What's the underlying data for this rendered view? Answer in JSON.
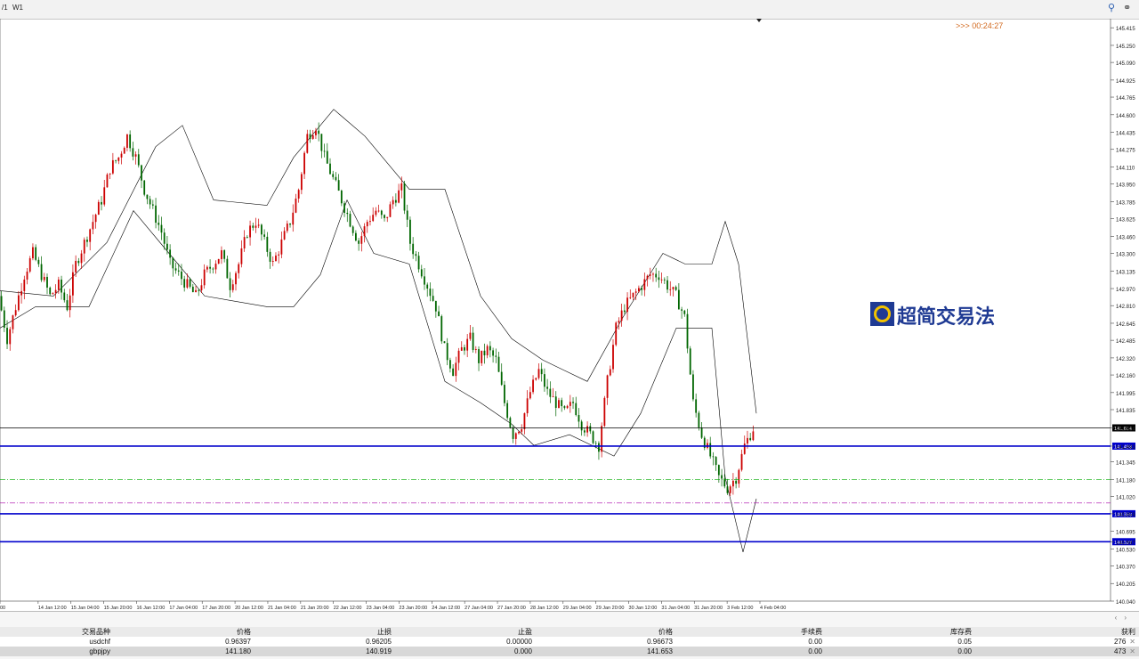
{
  "toolbar": {
    "timeframes": [
      "/1",
      "W1"
    ],
    "search_icon": "magnifier-icon",
    "tool_icon": "link-icon"
  },
  "countdown": ">>> 00:24:27",
  "watermark": {
    "text": "超简交易法",
    "icon": "logo-icon"
  },
  "chart_data": {
    "type": "candlestick",
    "symbol_price_current": 141.664,
    "y_ticks": [
      145.415,
      145.25,
      145.09,
      144.925,
      144.765,
      144.6,
      144.435,
      144.275,
      144.11,
      143.95,
      143.785,
      143.625,
      143.46,
      143.3,
      143.135,
      142.97,
      142.81,
      142.645,
      142.485,
      142.32,
      142.16,
      141.995,
      141.835,
      141.664,
      141.493,
      141.345,
      141.18,
      141.02,
      140.859,
      140.695,
      140.597,
      140.53,
      140.37,
      140.205,
      140.04
    ],
    "ylim": [
      140.04,
      145.5
    ],
    "x_ticks": [
      "00",
      "14 Jan 12:00",
      "15 Jan 04:00",
      "15 Jan 20:00",
      "16 Jan 12:00",
      "17 Jan 04:00",
      "17 Jan 20:00",
      "20 Jan 12:00",
      "21 Jan 04:00",
      "21 Jan 20:00",
      "22 Jan 12:00",
      "23 Jan 04:00",
      "23 Jan 20:00",
      "24 Jan 12:00",
      "27 Jan 04:00",
      "27 Jan 20:00",
      "28 Jan 12:00",
      "29 Jan 04:00",
      "29 Jan 20:00",
      "30 Jan 12:00",
      "31 Jan 04:00",
      "31 Jan 20:00",
      "3 Feb 12:00",
      "4 Feb 04:00"
    ],
    "price_trace": [
      142.9,
      142.5,
      142.8,
      143.1,
      143.3,
      143.1,
      142.9,
      143.0,
      142.8,
      143.2,
      143.4,
      143.6,
      143.8,
      144.1,
      144.2,
      144.4,
      144.2,
      143.9,
      143.7,
      143.5,
      143.2,
      143.1,
      143.0,
      142.9,
      143.1,
      143.2,
      143.3,
      143.0,
      143.2,
      143.5,
      143.6,
      143.4,
      143.2,
      143.4,
      143.6,
      143.9,
      144.4,
      144.5,
      144.2,
      144.0,
      143.8,
      143.6,
      143.4,
      143.6,
      143.7,
      143.6,
      143.8,
      143.9,
      143.4,
      143.2,
      143.0,
      142.8,
      142.4,
      142.2,
      142.4,
      142.5,
      142.3,
      142.4,
      142.3,
      141.9,
      141.6,
      141.7,
      142.0,
      142.2,
      142.0,
      141.9,
      141.8,
      141.9,
      141.7,
      141.6,
      141.5,
      142.1,
      142.6,
      142.8,
      142.9,
      143.0,
      143.1,
      143.1,
      143.0,
      142.9,
      142.7,
      141.9,
      141.6,
      141.4,
      141.2,
      141.1,
      141.2,
      141.5,
      141.66
    ],
    "upper_band_points": [
      [
        0,
        142.95
      ],
      [
        60,
        142.9
      ],
      [
        120,
        143.4
      ],
      [
        175,
        144.3
      ],
      [
        205,
        144.5
      ],
      [
        240,
        143.8
      ],
      [
        300,
        143.75
      ],
      [
        330,
        144.2
      ],
      [
        375,
        144.65
      ],
      [
        410,
        144.4
      ],
      [
        460,
        143.9
      ],
      [
        500,
        143.9
      ],
      [
        540,
        142.9
      ],
      [
        575,
        142.5
      ],
      [
        610,
        142.3
      ],
      [
        660,
        142.1
      ],
      [
        700,
        142.7
      ],
      [
        745,
        143.3
      ],
      [
        770,
        143.2
      ],
      [
        800,
        143.2
      ],
      [
        815,
        143.6
      ],
      [
        830,
        143.2
      ],
      [
        850,
        141.8
      ]
    ],
    "lower_band_points": [
      [
        0,
        142.6
      ],
      [
        40,
        142.8
      ],
      [
        100,
        142.8
      ],
      [
        150,
        143.7
      ],
      [
        190,
        143.3
      ],
      [
        230,
        142.9
      ],
      [
        300,
        142.8
      ],
      [
        330,
        142.8
      ],
      [
        360,
        143.1
      ],
      [
        390,
        143.8
      ],
      [
        420,
        143.3
      ],
      [
        460,
        143.2
      ],
      [
        500,
        142.1
      ],
      [
        540,
        141.9
      ],
      [
        575,
        141.7
      ],
      [
        600,
        141.5
      ],
      [
        640,
        141.6
      ],
      [
        690,
        141.4
      ],
      [
        720,
        141.8
      ],
      [
        760,
        142.6
      ],
      [
        800,
        142.6
      ],
      [
        815,
        141.2
      ],
      [
        835,
        140.5
      ],
      [
        850,
        141.0
      ]
    ],
    "horizontal_lines": [
      {
        "price": 141.664,
        "color": "#000000",
        "style": "solid",
        "label": "141.664"
      },
      {
        "price": 141.493,
        "color": "#0000cc",
        "style": "solid",
        "label": "141.493"
      },
      {
        "price": 141.18,
        "color": "#00aa00",
        "style": "dashdot",
        "label": ""
      },
      {
        "price": 140.96,
        "color": "#aa00aa",
        "style": "dashdot",
        "label": ""
      },
      {
        "price": 140.859,
        "color": "#0000cc",
        "style": "solid",
        "label": "140.859"
      },
      {
        "price": 140.597,
        "color": "#0000cc",
        "style": "solid",
        "label": "140.597"
      }
    ],
    "colors": {
      "bull": "#cc0000",
      "bear": "#006600",
      "band": "#000000"
    }
  },
  "orders": {
    "headers": [
      "交易品种",
      "价格",
      "止损",
      "止盈",
      "价格",
      "手续费",
      "库存费",
      "获利"
    ],
    "rows": [
      {
        "symbol": "usdchf",
        "open_price": "0.96397",
        "sl": "0.96205",
        "tp": "0.00000",
        "price": "0.96673",
        "commission": "0.00",
        "swap": "0.05",
        "profit": "276"
      },
      {
        "symbol": "gbpjpy",
        "open_price": "141.180",
        "sl": "140.919",
        "tp": "0.000",
        "price": "141.653",
        "commission": "0.00",
        "swap": "0.00",
        "profit": "473"
      }
    ]
  }
}
